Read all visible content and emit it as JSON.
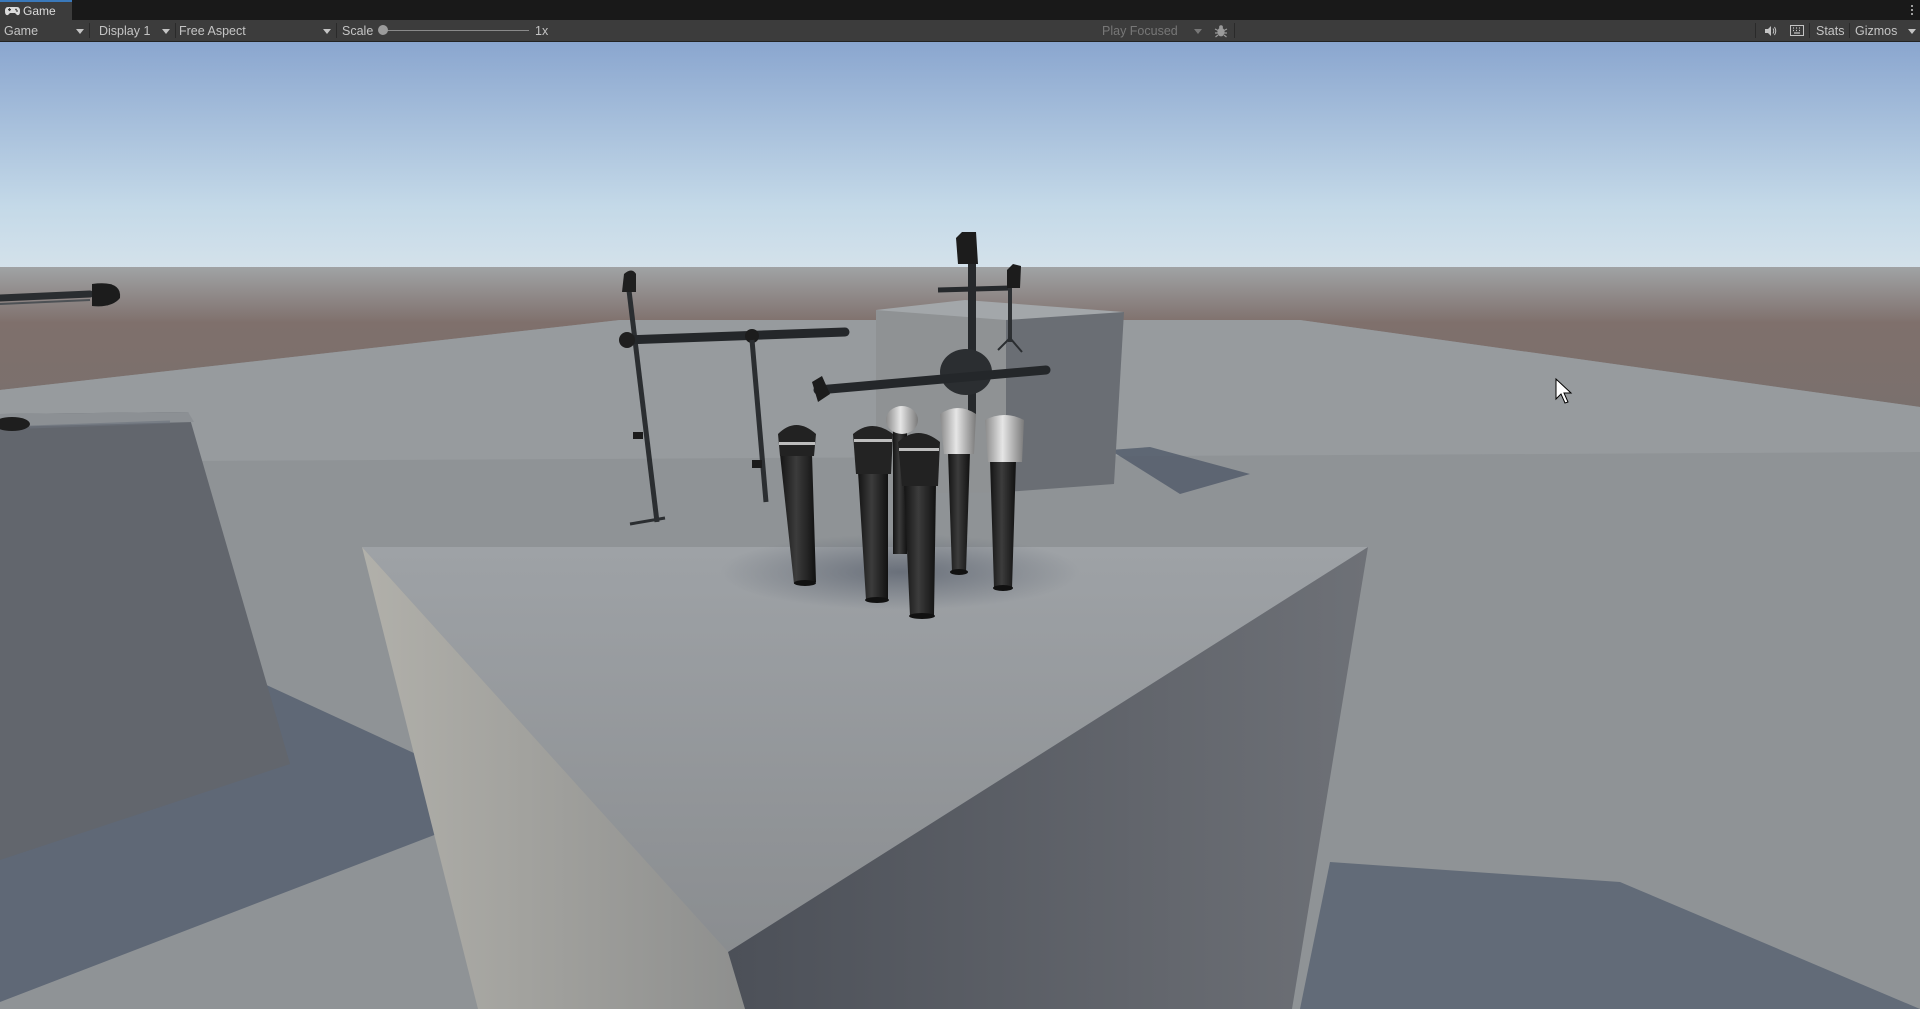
{
  "window": {
    "tab_title": "Game",
    "tab_icon": "gamepad-icon"
  },
  "toolbar": {
    "view_mode": "Game",
    "display": "Display 1",
    "aspect": "Free Aspect",
    "scale_label": "Scale",
    "scale_value": "1x",
    "scale_level": 1,
    "play_mode": "Play Focused",
    "bug_icon": "bug-icon",
    "audio_icon": "speaker-icon",
    "keyboard_icon": "keyboard-icon",
    "stats_label": "Stats",
    "gizmos_label": "Gizmos"
  },
  "colors": {
    "toolbar_bg": "#3c3c3c",
    "tab_accent": "#3a79bb",
    "text": "#c4c4c4",
    "sky_top": "#8aa8d0",
    "ground": "#847672",
    "platform": "#8d9093"
  }
}
